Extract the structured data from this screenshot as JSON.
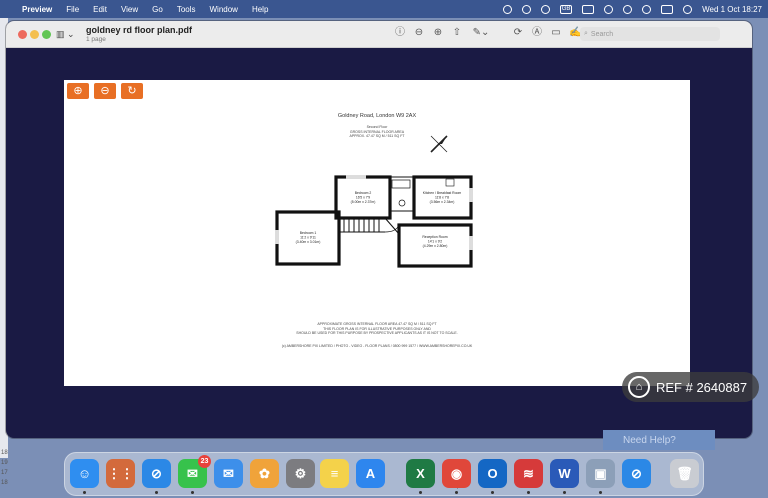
{
  "menubar": {
    "app_name": "Preview",
    "items": [
      "File",
      "Edit",
      "View",
      "Go",
      "Tools",
      "Window",
      "Help"
    ],
    "input_badge": "GB",
    "clock": "Wed 1 Oct  18:27"
  },
  "desktop": {
    "edge_numbers": [
      "18",
      "19",
      "17",
      "18"
    ]
  },
  "window": {
    "document_title": "goldney rd floor plan.pdf",
    "page_count": "1 page",
    "search_placeholder": "Search"
  },
  "floorplan": {
    "zoom_in_symbol": "⊕",
    "zoom_out_symbol": "⊖",
    "refresh_symbol": "↻",
    "address": "Goldney Road, London W9 2AX",
    "floor_lines": [
      "Second Floor",
      "GROSS INTERNAL FLOOR AREA",
      "APPROX. 47.47 SQ M / 511 SQ FT"
    ],
    "rooms": [
      {
        "name": "Bedroom 2",
        "size_imp": "16'5 x 7'9",
        "size_met": "(5.00m x 2.37m)"
      },
      {
        "name": "Kitchen / Breakfast Room",
        "size_imp": "11'8 x 7'8",
        "size_met": "(3.56m x 2.34m)"
      },
      {
        "name": "Bedroom 1",
        "size_imp": "11'2 x 9'11",
        "size_met": "(3.40m x 3.01m)"
      },
      {
        "name": "Reception Room",
        "size_imp": "14'1 x 9'2",
        "size_met": "(4.29m x 2.80m)"
      }
    ],
    "footer_lines": [
      "APPROXIMATE GROSS INTERNAL FLOOR AREA 47.47 SQ M / 511 SQ FT",
      "THIS FLOOR PLAN IS FOR ILLUSTRATIVE PURPOSES ONLY AND",
      "SHOULD BE USED FOR THIS PURPOSE BY PROSPECTIVE APPLICANTS AS IT IS NOT TO SCALE."
    ],
    "copyright": "(c) AMBERSHORE PIX LIMITED / PHOTO - VIDEO - FLOOR PLANS / 0800 999 1577 / WWW.AMBERSHOREPIX.CO.UK"
  },
  "watermark": {
    "ref_text": "REF # 2640887",
    "icon_glyph": "⌂"
  },
  "help": {
    "label": "Need Help?"
  },
  "dock": {
    "apps": [
      {
        "name": "Finder",
        "color": "#2f8ef0",
        "glyph": "☺",
        "badge": "",
        "running": true
      },
      {
        "name": "Launchpad",
        "color": "#d36a3c",
        "glyph": "⋮⋮",
        "badge": "",
        "running": false
      },
      {
        "name": "Safari",
        "color": "#2b88e6",
        "glyph": "⊘",
        "badge": "",
        "running": true
      },
      {
        "name": "Messages",
        "color": "#37c24c",
        "glyph": "✉",
        "badge": "23",
        "running": true
      },
      {
        "name": "Mail",
        "color": "#3d8fea",
        "glyph": "✉",
        "badge": "",
        "running": false
      },
      {
        "name": "Photos",
        "color": "#f0a33a",
        "glyph": "✿",
        "badge": "",
        "running": false
      },
      {
        "name": "System Settings",
        "color": "#7c7c80",
        "glyph": "⚙",
        "badge": "",
        "running": false
      },
      {
        "name": "Notes",
        "color": "#f4d24a",
        "glyph": "≡",
        "badge": "",
        "running": false
      },
      {
        "name": "App Store",
        "color": "#2e86ee",
        "glyph": "A",
        "badge": "",
        "running": false
      },
      {
        "name": "Excel",
        "color": "#1f7a44",
        "glyph": "X",
        "badge": "",
        "running": true
      },
      {
        "name": "Chrome",
        "color": "#e0473a",
        "glyph": "◉",
        "badge": "",
        "running": true
      },
      {
        "name": "Outlook",
        "color": "#1467c4",
        "glyph": "O",
        "badge": "",
        "running": true
      },
      {
        "name": "Office",
        "color": "#d63a3a",
        "glyph": "≋",
        "badge": "",
        "running": true
      },
      {
        "name": "Word",
        "color": "#2a5ab8",
        "glyph": "W",
        "badge": "",
        "running": true
      },
      {
        "name": "Preview",
        "color": "#8c9fb8",
        "glyph": "▣",
        "badge": "",
        "running": true
      },
      {
        "name": "Safari",
        "color": "#2b88e6",
        "glyph": "⊘",
        "badge": "",
        "running": false
      },
      {
        "name": "Trash",
        "color": "#c9ccd2",
        "glyph": "🗑",
        "badge": "",
        "running": false
      }
    ]
  }
}
